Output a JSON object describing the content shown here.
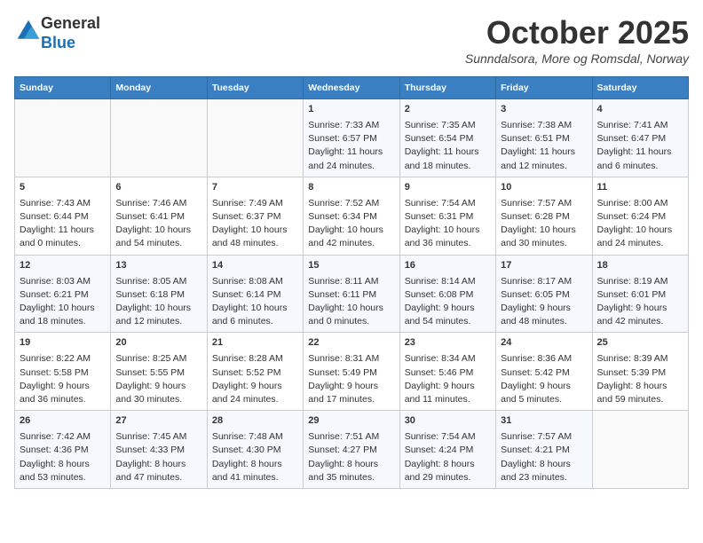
{
  "header": {
    "logo_line1": "General",
    "logo_line2": "Blue",
    "month": "October 2025",
    "location": "Sunndalsora, More og Romsdal, Norway"
  },
  "columns": [
    "Sunday",
    "Monday",
    "Tuesday",
    "Wednesday",
    "Thursday",
    "Friday",
    "Saturday"
  ],
  "weeks": [
    {
      "days": [
        {
          "num": "",
          "lines": []
        },
        {
          "num": "",
          "lines": []
        },
        {
          "num": "",
          "lines": []
        },
        {
          "num": "1",
          "lines": [
            "Sunrise: 7:33 AM",
            "Sunset: 6:57 PM",
            "Daylight: 11 hours",
            "and 24 minutes."
          ]
        },
        {
          "num": "2",
          "lines": [
            "Sunrise: 7:35 AM",
            "Sunset: 6:54 PM",
            "Daylight: 11 hours",
            "and 18 minutes."
          ]
        },
        {
          "num": "3",
          "lines": [
            "Sunrise: 7:38 AM",
            "Sunset: 6:51 PM",
            "Daylight: 11 hours",
            "and 12 minutes."
          ]
        },
        {
          "num": "4",
          "lines": [
            "Sunrise: 7:41 AM",
            "Sunset: 6:47 PM",
            "Daylight: 11 hours",
            "and 6 minutes."
          ]
        }
      ]
    },
    {
      "days": [
        {
          "num": "5",
          "lines": [
            "Sunrise: 7:43 AM",
            "Sunset: 6:44 PM",
            "Daylight: 11 hours",
            "and 0 minutes."
          ]
        },
        {
          "num": "6",
          "lines": [
            "Sunrise: 7:46 AM",
            "Sunset: 6:41 PM",
            "Daylight: 10 hours",
            "and 54 minutes."
          ]
        },
        {
          "num": "7",
          "lines": [
            "Sunrise: 7:49 AM",
            "Sunset: 6:37 PM",
            "Daylight: 10 hours",
            "and 48 minutes."
          ]
        },
        {
          "num": "8",
          "lines": [
            "Sunrise: 7:52 AM",
            "Sunset: 6:34 PM",
            "Daylight: 10 hours",
            "and 42 minutes."
          ]
        },
        {
          "num": "9",
          "lines": [
            "Sunrise: 7:54 AM",
            "Sunset: 6:31 PM",
            "Daylight: 10 hours",
            "and 36 minutes."
          ]
        },
        {
          "num": "10",
          "lines": [
            "Sunrise: 7:57 AM",
            "Sunset: 6:28 PM",
            "Daylight: 10 hours",
            "and 30 minutes."
          ]
        },
        {
          "num": "11",
          "lines": [
            "Sunrise: 8:00 AM",
            "Sunset: 6:24 PM",
            "Daylight: 10 hours",
            "and 24 minutes."
          ]
        }
      ]
    },
    {
      "days": [
        {
          "num": "12",
          "lines": [
            "Sunrise: 8:03 AM",
            "Sunset: 6:21 PM",
            "Daylight: 10 hours",
            "and 18 minutes."
          ]
        },
        {
          "num": "13",
          "lines": [
            "Sunrise: 8:05 AM",
            "Sunset: 6:18 PM",
            "Daylight: 10 hours",
            "and 12 minutes."
          ]
        },
        {
          "num": "14",
          "lines": [
            "Sunrise: 8:08 AM",
            "Sunset: 6:14 PM",
            "Daylight: 10 hours",
            "and 6 minutes."
          ]
        },
        {
          "num": "15",
          "lines": [
            "Sunrise: 8:11 AM",
            "Sunset: 6:11 PM",
            "Daylight: 10 hours",
            "and 0 minutes."
          ]
        },
        {
          "num": "16",
          "lines": [
            "Sunrise: 8:14 AM",
            "Sunset: 6:08 PM",
            "Daylight: 9 hours",
            "and 54 minutes."
          ]
        },
        {
          "num": "17",
          "lines": [
            "Sunrise: 8:17 AM",
            "Sunset: 6:05 PM",
            "Daylight: 9 hours",
            "and 48 minutes."
          ]
        },
        {
          "num": "18",
          "lines": [
            "Sunrise: 8:19 AM",
            "Sunset: 6:01 PM",
            "Daylight: 9 hours",
            "and 42 minutes."
          ]
        }
      ]
    },
    {
      "days": [
        {
          "num": "19",
          "lines": [
            "Sunrise: 8:22 AM",
            "Sunset: 5:58 PM",
            "Daylight: 9 hours",
            "and 36 minutes."
          ]
        },
        {
          "num": "20",
          "lines": [
            "Sunrise: 8:25 AM",
            "Sunset: 5:55 PM",
            "Daylight: 9 hours",
            "and 30 minutes."
          ]
        },
        {
          "num": "21",
          "lines": [
            "Sunrise: 8:28 AM",
            "Sunset: 5:52 PM",
            "Daylight: 9 hours",
            "and 24 minutes."
          ]
        },
        {
          "num": "22",
          "lines": [
            "Sunrise: 8:31 AM",
            "Sunset: 5:49 PM",
            "Daylight: 9 hours",
            "and 17 minutes."
          ]
        },
        {
          "num": "23",
          "lines": [
            "Sunrise: 8:34 AM",
            "Sunset: 5:46 PM",
            "Daylight: 9 hours",
            "and 11 minutes."
          ]
        },
        {
          "num": "24",
          "lines": [
            "Sunrise: 8:36 AM",
            "Sunset: 5:42 PM",
            "Daylight: 9 hours",
            "and 5 minutes."
          ]
        },
        {
          "num": "25",
          "lines": [
            "Sunrise: 8:39 AM",
            "Sunset: 5:39 PM",
            "Daylight: 8 hours",
            "and 59 minutes."
          ]
        }
      ]
    },
    {
      "days": [
        {
          "num": "26",
          "lines": [
            "Sunrise: 7:42 AM",
            "Sunset: 4:36 PM",
            "Daylight: 8 hours",
            "and 53 minutes."
          ]
        },
        {
          "num": "27",
          "lines": [
            "Sunrise: 7:45 AM",
            "Sunset: 4:33 PM",
            "Daylight: 8 hours",
            "and 47 minutes."
          ]
        },
        {
          "num": "28",
          "lines": [
            "Sunrise: 7:48 AM",
            "Sunset: 4:30 PM",
            "Daylight: 8 hours",
            "and 41 minutes."
          ]
        },
        {
          "num": "29",
          "lines": [
            "Sunrise: 7:51 AM",
            "Sunset: 4:27 PM",
            "Daylight: 8 hours",
            "and 35 minutes."
          ]
        },
        {
          "num": "30",
          "lines": [
            "Sunrise: 7:54 AM",
            "Sunset: 4:24 PM",
            "Daylight: 8 hours",
            "and 29 minutes."
          ]
        },
        {
          "num": "31",
          "lines": [
            "Sunrise: 7:57 AM",
            "Sunset: 4:21 PM",
            "Daylight: 8 hours",
            "and 23 minutes."
          ]
        },
        {
          "num": "",
          "lines": []
        }
      ]
    }
  ]
}
